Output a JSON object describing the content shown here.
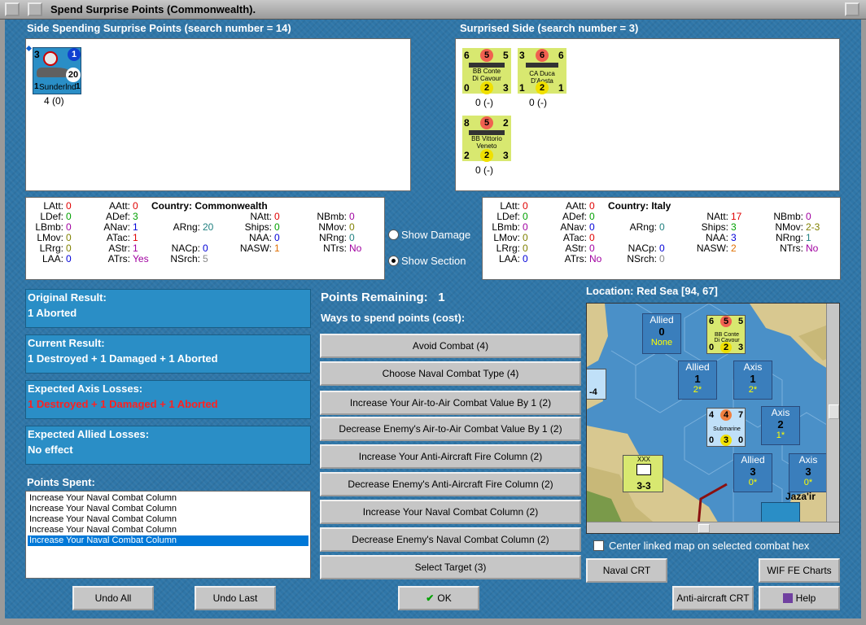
{
  "window": {
    "title": "Spend Surprise Points (Commonwealth)."
  },
  "spending": {
    "header": "Side Spending Surprise Points (search number = 14)",
    "unit": {
      "name": "Sunderlnd",
      "top_left": "3",
      "top_right": "1",
      "value": "20",
      "bottom_left": "1",
      "bottom_right": "1",
      "label": "4 (0)"
    }
  },
  "surprised": {
    "header": "Surprised Side (search number = 3)",
    "units": [
      {
        "name1": "BB Conte",
        "name2": "Di Cavour",
        "tl": "6",
        "tc": "5",
        "tr": "5",
        "bl": "0",
        "bc": "2",
        "br": "3",
        "label": "0 (-)"
      },
      {
        "name1": "CA Duca D'Aosta",
        "name2": "",
        "tl": "3",
        "tc": "6",
        "tr": "6",
        "bl": "1",
        "bc": "2",
        "br": "1",
        "label": "0 (-)"
      },
      {
        "name1": "BB Vittorio",
        "name2": "Veneto",
        "tl": "8",
        "tc": "5",
        "tr": "2",
        "bl": "2",
        "bc": "2",
        "br": "3",
        "label": "0 (-)"
      }
    ]
  },
  "left_stats": {
    "country_label": "Country:",
    "country": "Commonwealth",
    "LAtt": "0",
    "LDef": "0",
    "LBmb": "0",
    "LMov": "0",
    "LRrg": "0",
    "LAA": "0",
    "AAtt": "0",
    "ADef": "3",
    "ANav": "1",
    "ATac": "1",
    "AStr": "1",
    "ATrs": "Yes",
    "ARng": "20",
    "NACp": "0",
    "NSrch": "5",
    "NAtt": "0",
    "Ships": "0",
    "NAA": "0",
    "NASW": "1",
    "NBmb": "0",
    "NMov": "0",
    "NRng": "0",
    "NTrs": "No"
  },
  "right_stats": {
    "country_label": "Country:",
    "country": "Italy",
    "LAtt": "0",
    "LDef": "0",
    "LBmb": "0",
    "LMov": "0",
    "LRrg": "0",
    "LAA": "0",
    "AAtt": "0",
    "ADef": "0",
    "ANav": "0",
    "ATac": "0",
    "AStr": "0",
    "ATrs": "No",
    "ARng": "0",
    "NACp": "0",
    "NSrch": "0",
    "NAtt": "17",
    "Ships": "3",
    "NAA": "3",
    "NASW": "2",
    "NBmb": "0",
    "NMov": "2-3",
    "NRng": "1",
    "NTrs": "No"
  },
  "stat_labels": {
    "LAtt": "LAtt:",
    "LDef": "LDef:",
    "LBmb": "LBmb:",
    "LMov": "LMov:",
    "LRrg": "LRrg:",
    "LAA": "LAA:",
    "AAtt": "AAtt:",
    "ADef": "ADef:",
    "ANav": "ANav:",
    "ATac": "ATac:",
    "AStr": "AStr:",
    "ATrs": "ATrs:",
    "ARng": "ARng:",
    "NACp": "NACp:",
    "NSrch": "NSrch:",
    "NAtt": "NAtt:",
    "Ships": "Ships:",
    "NAA": "NAA:",
    "NASW": "NASW:",
    "NBmb": "NBmb:",
    "NMov": "NMov:",
    "NRng": "NRng:",
    "NTrs": "NTrs:"
  },
  "options": {
    "show_damage": "Show Damage",
    "show_section": "Show Section",
    "selected": "show_section"
  },
  "results": {
    "original_title": "Original Result:",
    "original": "1 Aborted",
    "current_title": "Current Result:",
    "current": "1 Destroyed + 1 Damaged + 1 Aborted",
    "axis_title": "Expected Axis Losses:",
    "axis": "1 Destroyed + 1 Damaged + 1 Aborted",
    "allied_title": "Expected Allied Losses:",
    "allied": "No effect"
  },
  "points_spent": {
    "title": "Points Spent:",
    "items": [
      "Increase Your Naval Combat Column",
      "Increase Your Naval Combat Column",
      "Increase Your Naval Combat Column",
      "Increase Your Naval Combat Column",
      "Increase Your Naval Combat Column"
    ]
  },
  "points": {
    "remaining_label": "Points Remaining:",
    "remaining": "1",
    "ways_label": "Ways to spend points (cost):"
  },
  "actions": [
    "Avoid Combat (4)",
    "Choose Naval Combat Type (4)",
    "Increase Your Air-to-Air Combat Value By 1 (2)",
    "Decrease Enemy's Air-to-Air Combat Value By 1 (2)",
    "Increase Your Anti-Aircraft Fire Column (2)",
    "Decrease Enemy's Anti-Aircraft Fire Column (2)",
    "Increase Your Naval Combat Column (2)",
    "Decrease Enemy's Naval Combat Column (2)",
    "Select Target (3)"
  ],
  "map": {
    "location": "Location: Red Sea [94, 67]",
    "place": "Jaza'ir",
    "boxes": [
      {
        "side": "Allied",
        "num": "0",
        "sub": "None"
      },
      {
        "side": "Allied",
        "num": "1",
        "sub": "2*"
      },
      {
        "side": "Axis",
        "num": "1",
        "sub": "2*"
      },
      {
        "side": "Axis",
        "num": "2",
        "sub": "1*"
      },
      {
        "side": "Allied",
        "num": "3",
        "sub": "0*"
      },
      {
        "side": "Axis",
        "num": "3",
        "sub": "0*"
      }
    ],
    "sub_counter": {
      "name": "Submarine",
      "tl": "4",
      "tc": "4",
      "tr": "7",
      "bl": "0",
      "bc": "3",
      "br": "0"
    },
    "army_counter": {
      "label": "3-3",
      "top": "XXX"
    },
    "left_counter": "-4",
    "center_label": "Center linked map on selected combat hex"
  },
  "buttons": {
    "naval_crt": "Naval CRT",
    "wif_charts": "WIF FE Charts",
    "aa_crt": "Anti-aircraft CRT",
    "help": "Help",
    "undo_all": "Undo All",
    "undo_last": "Undo Last",
    "ok": "OK"
  }
}
